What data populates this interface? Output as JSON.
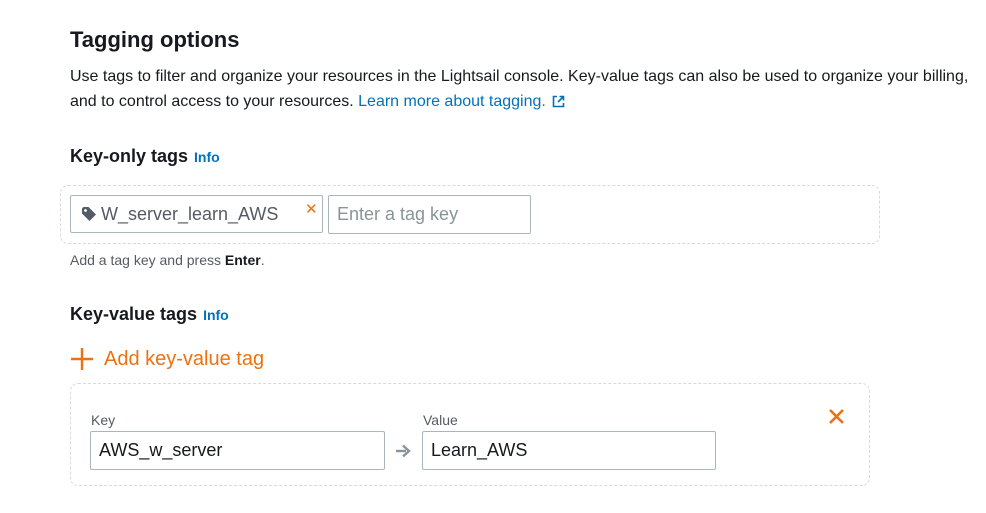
{
  "section": {
    "title": "Tagging options",
    "description": "Use tags to filter and organize your resources in the Lightsail console. Key-value tags can also be used to organize your billing, and to control access to your resources.",
    "learn_more": "Learn more about tagging."
  },
  "key_only": {
    "title": "Key-only tags",
    "info": "Info",
    "tags": [
      {
        "label": "W_server_learn_AWS"
      }
    ],
    "input_placeholder": "Enter a tag key",
    "hint_prefix": "Add a tag key and press",
    "hint_key": "Enter",
    "hint_suffix": "."
  },
  "key_value": {
    "title": "Key-value tags",
    "info": "Info",
    "add_label": "Add key-value tag",
    "rows": [
      {
        "key_label": "Key",
        "key_value": "AWS_w_server",
        "value_label": "Value",
        "value_value": "Learn_AWS"
      }
    ]
  },
  "colors": {
    "accent": "#ec7211",
    "link": "#0073bb",
    "text": "#16191f"
  },
  "icons": [
    "external-link-icon",
    "tag-icon",
    "close-icon",
    "plus-icon",
    "arrow-right-icon"
  ]
}
